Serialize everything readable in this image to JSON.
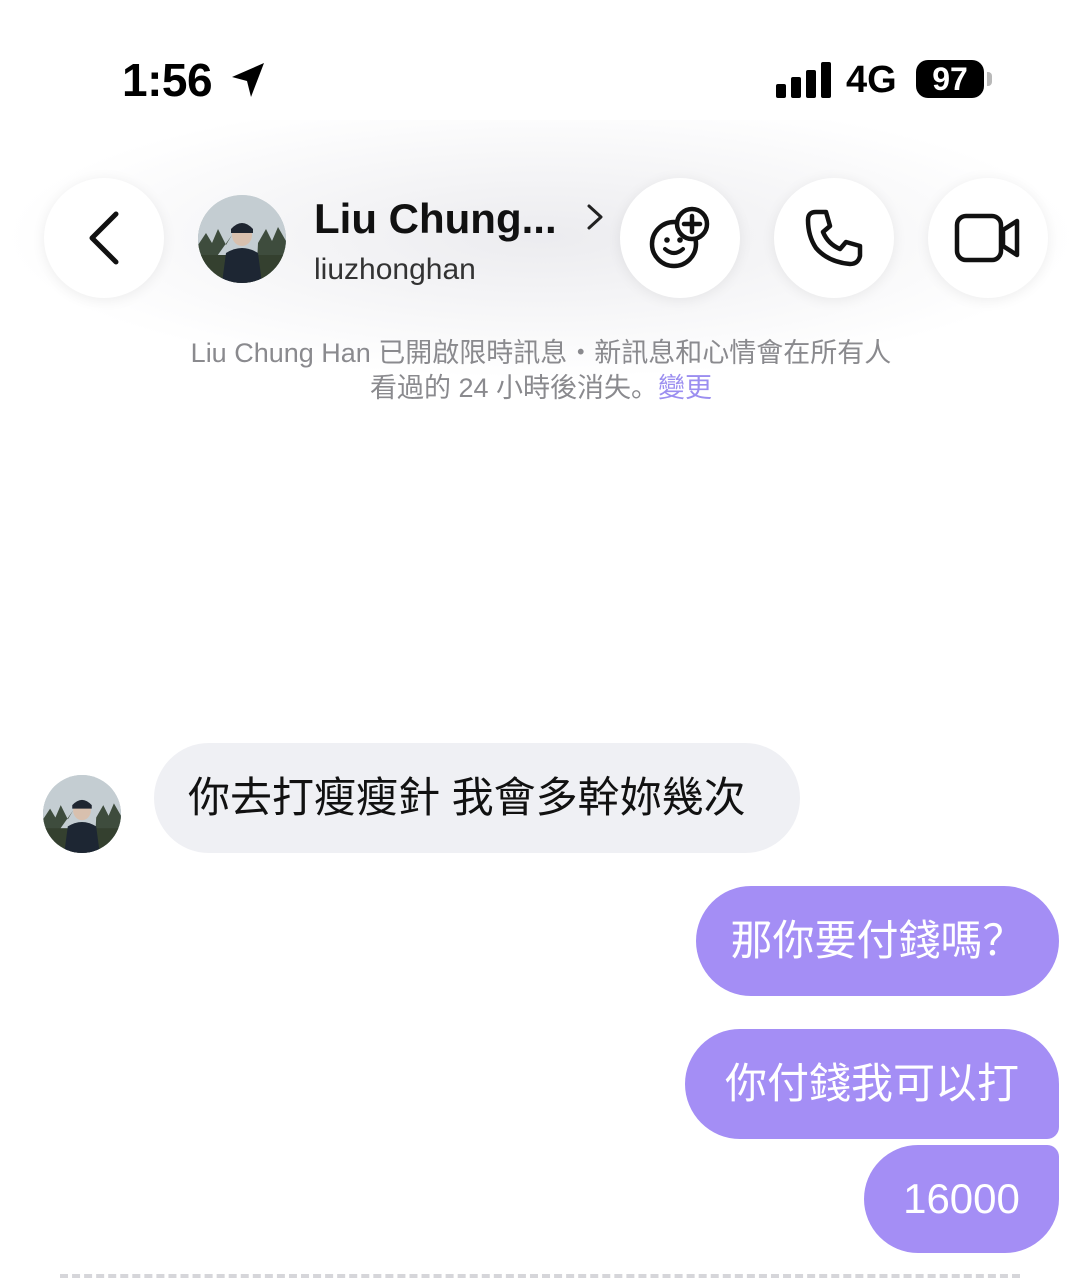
{
  "status_bar": {
    "time": "1:56",
    "network": "4G",
    "battery": "97",
    "icons": [
      "location-arrow-icon",
      "signal-bars-icon",
      "battery-icon"
    ]
  },
  "header": {
    "contact_name": "Liu Chung...",
    "username": "liuzhonghan",
    "icons": [
      "back-chevron-icon",
      "effects-icon",
      "phone-icon",
      "video-camera-icon",
      "chevron-right-icon"
    ]
  },
  "notice": {
    "line1": "Liu Chung Han 已開啟限時訊息・新訊息和心情會在所有人",
    "line2": "看過的 24 小時後消失。",
    "link": "變更",
    "link_color": "#9b8ef0"
  },
  "messages": [
    {
      "direction": "incoming",
      "text": "你去打瘦瘦針 我會多幹妳幾次"
    },
    {
      "direction": "outgoing",
      "text": "那你要付錢嗎？"
    },
    {
      "direction": "outgoing",
      "text": "你付錢我可以打"
    },
    {
      "direction": "outgoing",
      "text": "16000"
    }
  ],
  "colors": {
    "outgoing_bubble": "#a48ef5",
    "incoming_bubble": "#eff0f4"
  }
}
